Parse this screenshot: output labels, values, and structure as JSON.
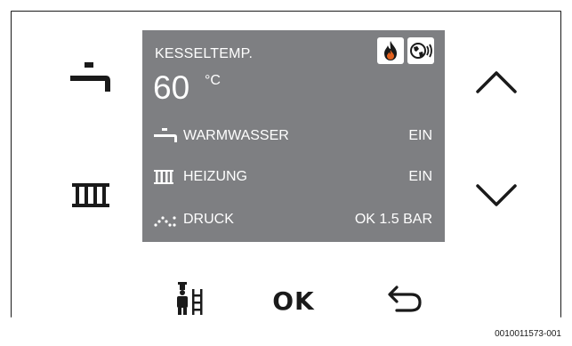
{
  "screen": {
    "title": "KESSELTEMP.",
    "temperature": "60",
    "unit": "°C",
    "status_icons": [
      "flame-icon",
      "internet-connection-icon"
    ],
    "rows": [
      {
        "icon": "hot-water-tap-icon",
        "label": "WARMWASSER",
        "value": "EIN"
      },
      {
        "icon": "radiator-icon",
        "label": "HEIZUNG",
        "value": "EIN"
      },
      {
        "icon": "pressure-icon",
        "label": "DRUCK",
        "value": "OK 1.5 BAR"
      }
    ]
  },
  "buttons": {
    "hot_water": {
      "icon": "hot-water-tap-icon"
    },
    "heating": {
      "icon": "radiator-icon"
    },
    "up": {
      "icon": "chevron-up-icon"
    },
    "down": {
      "icon": "chevron-down-icon"
    },
    "chimney_sweep": {
      "icon": "chimney-sweep-icon"
    },
    "ok_label": "OK",
    "back": {
      "icon": "back-arrow-icon"
    }
  },
  "figure_code": "0010011573-001",
  "colors": {
    "screen_background": "#7e7f82",
    "screen_text": "#ffffff",
    "icon_color": "#1a1a1a",
    "flame": "#e2611e"
  }
}
